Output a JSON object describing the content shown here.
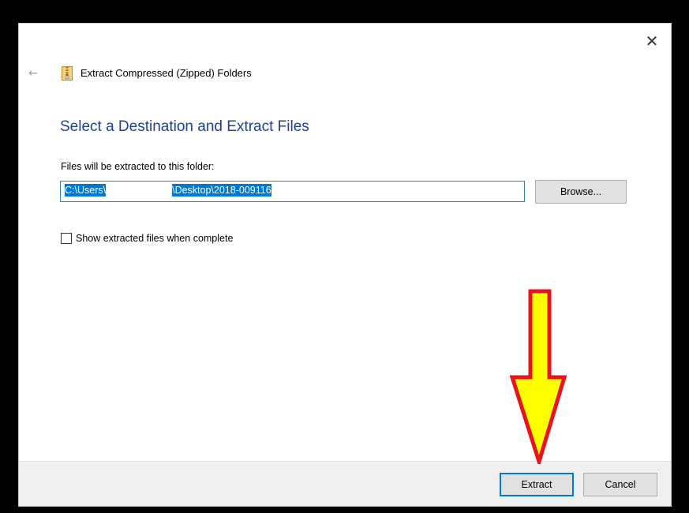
{
  "dialog": {
    "wizard_title": "Extract Compressed (Zipped) Folders",
    "close_glyph": "✕",
    "back_glyph": "←",
    "heading": "Select a Destination and Extract Files",
    "field_label": "Files will be extracted to this folder:",
    "path_prefix": "C:\\Users\\",
    "path_suffix": "\\Desktop\\2018-009116",
    "browse_label": "Browse...",
    "checkbox_label": "Show extracted files when complete",
    "checkbox_checked": false,
    "extract_label": "Extract",
    "cancel_label": "Cancel"
  },
  "colors": {
    "heading": "#1e3f9a",
    "selection": "#0078d7",
    "focus_border": "#0078d7",
    "footer_bg": "#f0f0f0",
    "annotation_arrow_fill": "#ffff00",
    "annotation_arrow_stroke": "#e8141b"
  },
  "icons": {
    "back": "back-arrow-icon",
    "title": "zip-folder-icon",
    "close": "close-icon",
    "annotation": "down-arrow-annotation"
  }
}
